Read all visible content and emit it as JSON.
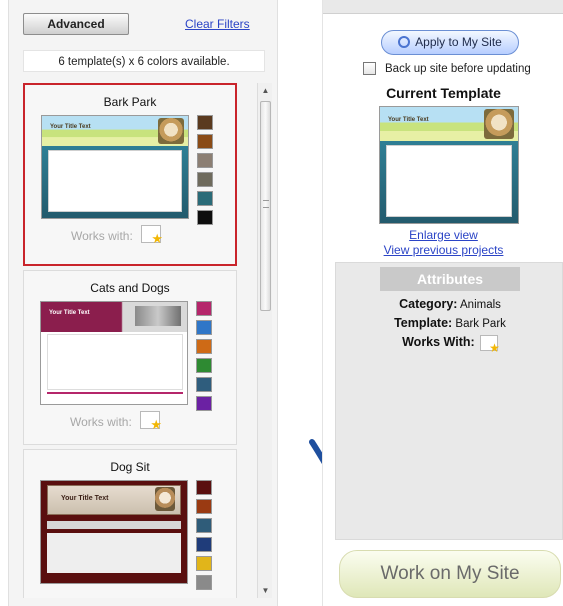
{
  "left": {
    "advanced_label": "Advanced",
    "clear_filters_label": "Clear Filters",
    "availability_text": "6 template(s) x 6 colors available.",
    "works_with_label": "Works with:",
    "templates": [
      {
        "name": "Bark Park",
        "selected": true,
        "thumb_title": "Your Title Text",
        "colors": [
          "#5a3a1f",
          "#8a4b16",
          "#8c7f73",
          "#6f6b5d",
          "#2a6b78",
          "#0e0e0e"
        ]
      },
      {
        "name": "Cats and Dogs",
        "selected": false,
        "thumb_title": "Your Title Text",
        "colors": [
          "#b5266b",
          "#2f76c7",
          "#ce6a16",
          "#2e8a32",
          "#2f5d7d",
          "#6b21a3"
        ]
      },
      {
        "name": "Dog Sit",
        "selected": false,
        "thumb_title": "Your Title Text",
        "colors": [
          "#5a0f0f",
          "#9a3a12",
          "#2f5c79",
          "#1f3c7a",
          "#e1b51a",
          "#8a8a8a"
        ]
      }
    ]
  },
  "right": {
    "apply_label": "Apply to My Site",
    "backup_label": "Back up site before updating",
    "current_template_heading": "Current Template",
    "current_thumb_title": "Your Title Text",
    "enlarge_label": "Enlarge view",
    "previous_label": "View previous projects",
    "attributes_heading": "Attributes",
    "category_key": "Category:",
    "category_value": "Animals",
    "template_key": "Template:",
    "template_value": "Bark Park",
    "works_with_key": "Works With:",
    "work_button_label": "Work on My Site"
  },
  "colors": {
    "selected_border": "#c9242b",
    "link": "#2b44c6",
    "arrow": "#1f4f9e"
  }
}
